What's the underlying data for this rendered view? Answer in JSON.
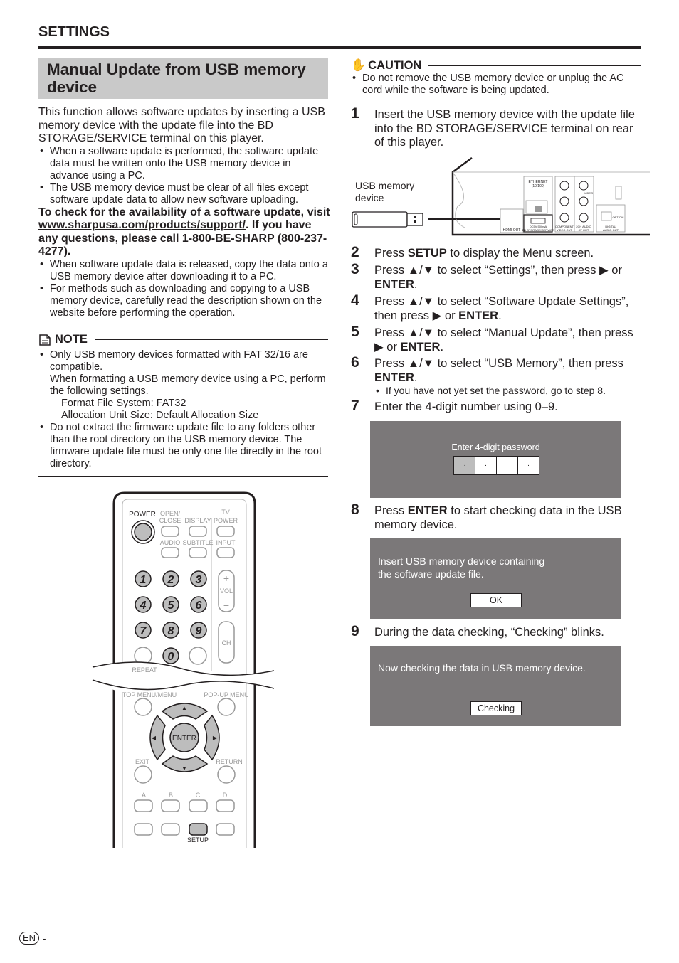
{
  "header": {
    "section": "SETTINGS"
  },
  "title": "Manual Update from USB memory device",
  "intro": "This function allows software updates by inserting a USB memory device with the update file into the BD STORAGE/SERVICE terminal on this player.",
  "bullets1": [
    "When a software update is performed, the software update data must be written onto the USB memory device in advance using a PC.",
    "The USB memory device must be clear of all files except software update data to allow new software uploading."
  ],
  "check": {
    "before": "To check for the availability of a software update, visit ",
    "link": "www.sharpusa.com/products/support/",
    "after": ". If you have any questions, please call 1-800-BE-SHARP (800-237-4277)."
  },
  "bullets2": [
    "When software update data is released, copy the data onto a USB memory device after downloading it to a PC.",
    "For methods such as downloading and copying to a USB memory device, carefully read the description shown on the website before performing the operation."
  ],
  "note": {
    "heading": "NOTE",
    "items": [
      {
        "lines": [
          "Only USB memory devices formatted with FAT 32/16 are compatible.",
          "When formatting a USB memory device using a PC, perform the following settings."
        ],
        "indented": [
          "Format File System: FAT32",
          "Allocation Unit Size: Default Allocation Size"
        ]
      },
      {
        "lines": [
          "Do not extract the firmware update file to any folders other than the root directory on the USB memory device. The firmware update file must be only one file directly in the root directory."
        ]
      }
    ]
  },
  "remote": {
    "labels": {
      "power": "POWER",
      "open_close_1": "OPEN/",
      "open_close_2": "CLOSE",
      "display": "DISPLAY",
      "tv": "TV",
      "tv_power": "POWER",
      "audio": "AUDIO",
      "subtitle": "SUBTITLE",
      "input": "INPUT",
      "vol": "VOL",
      "ch": "CH",
      "repeat": "REPEAT",
      "top_menu": "TOP MENU/MENU",
      "popup_menu": "POP-UP MENU",
      "enter": "ENTER",
      "exit": "EXIT",
      "return": "RETURN",
      "a": "A",
      "b": "B",
      "c": "C",
      "d": "D",
      "setup": "SETUP"
    },
    "digits": [
      "1",
      "2",
      "3",
      "4",
      "5",
      "6",
      "7",
      "8",
      "9",
      "0"
    ]
  },
  "caution": {
    "heading": "CAUTION",
    "items": [
      "Do not remove the USB memory device or unplug the AC cord while the software is being updated."
    ]
  },
  "illustration": {
    "usb_label_1": "USB memory",
    "usb_label_2": "device",
    "ethernet": "ETHERNET",
    "ethernet_sub": "(10/100)",
    "hdmi_out": "HDMI OUT",
    "bd_storage_1": "DC5V 500mA",
    "bd_storage_2": "BD STORAGE/SERVICE",
    "component": "COMPONENT",
    "video_out": "VIDEO OUT",
    "audio_2ch": "2CH AUDIO",
    "av_out": "AV OUT",
    "digital": "DIGITAL",
    "audio_out": "AUDIO OUT",
    "optical": "OPTICAL",
    "video": "VIDEO"
  },
  "steps": [
    {
      "n": "1",
      "segs": [
        {
          "t": "Insert the USB memory device with the update file into the BD STORAGE/SERVICE terminal on rear of this player."
        }
      ]
    },
    {
      "n": "2",
      "segs": [
        {
          "t": "Press "
        },
        {
          "t": "SETUP",
          "b": true
        },
        {
          "t": " to display the Menu screen."
        }
      ]
    },
    {
      "n": "3",
      "segs": [
        {
          "t": "Press ▲/▼ to select “Settings”, then press ▶ or "
        },
        {
          "t": "ENTER",
          "b": true
        },
        {
          "t": "."
        }
      ]
    },
    {
      "n": "4",
      "segs": [
        {
          "t": "Press ▲/▼ to select “Software Update Settings”, then press ▶ or "
        },
        {
          "t": "ENTER",
          "b": true
        },
        {
          "t": "."
        }
      ]
    },
    {
      "n": "5",
      "segs": [
        {
          "t": "Press ▲/▼ to select “Manual Update”, then press ▶ or "
        },
        {
          "t": "ENTER",
          "b": true
        },
        {
          "t": "."
        }
      ]
    },
    {
      "n": "6",
      "segs": [
        {
          "t": "Press ▲/▼ to select “USB Memory”, then press "
        },
        {
          "t": "ENTER",
          "b": true
        },
        {
          "t": "."
        }
      ],
      "sub": "If you have not yet set the password, go to step 8."
    },
    {
      "n": "7",
      "segs": [
        {
          "t": "Enter the 4-digit number using 0–9."
        }
      ]
    },
    {
      "n": "8",
      "segs": [
        {
          "t": "Press "
        },
        {
          "t": "ENTER",
          "b": true
        },
        {
          "t": " to start checking data in the USB memory device."
        }
      ]
    },
    {
      "n": "9",
      "segs": [
        {
          "t": "During the data checking, “Checking” blinks."
        }
      ]
    }
  ],
  "dialogs": {
    "password": {
      "label": "Enter 4-digit password",
      "digits": [
        "·",
        "·",
        "·",
        "·"
      ]
    },
    "insert": {
      "line1": "Insert USB memory device containing",
      "line2": "the software update file.",
      "button": "OK"
    },
    "checking": {
      "text": "Now checking the data in USB memory device.",
      "button": "Checking"
    }
  },
  "footer": {
    "lang": "EN",
    "dash": "-"
  },
  "colors": {
    "dialog_bg": "#7b7879",
    "title_bg": "#c9c9c9",
    "button_gray": "#bdbdbd"
  }
}
